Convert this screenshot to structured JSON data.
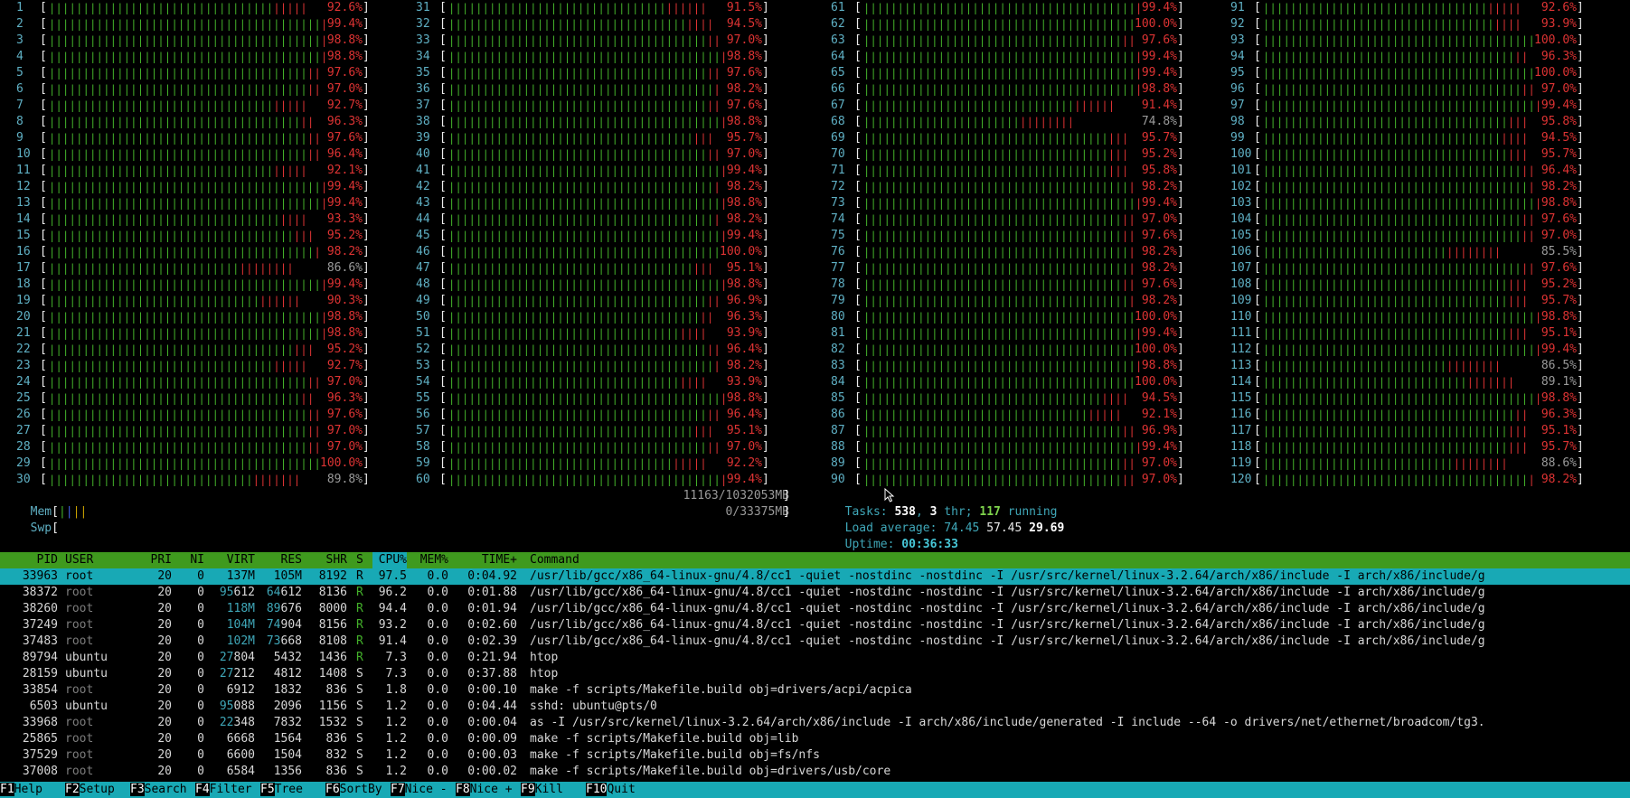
{
  "cpu_columns": [
    {
      "ids": [
        "1",
        "2",
        "3",
        "4",
        "5",
        "6",
        "7",
        "8",
        "9",
        "10",
        "11",
        "12",
        "13",
        "14",
        "15",
        "16",
        "17",
        "18",
        "19",
        "20",
        "21",
        "22",
        "23",
        "24",
        "25",
        "26",
        "27",
        "28",
        "29",
        "30"
      ],
      "values": [
        "92.6%",
        "99.4%",
        "98.8%",
        "98.8%",
        "97.6%",
        "97.0%",
        "92.7%",
        "96.3%",
        "97.6%",
        "96.4%",
        "92.1%",
        "99.4%",
        "99.4%",
        "93.3%",
        "95.2%",
        "98.2%",
        "86.6%",
        "99.4%",
        "90.3%",
        "98.8%",
        "98.8%",
        "95.2%",
        "92.7%",
        "97.0%",
        "96.3%",
        "97.6%",
        "97.0%",
        "97.0%",
        "100.0%",
        "89.8%"
      ],
      "levels": [
        92.6,
        99.4,
        98.8,
        98.8,
        97.6,
        97.0,
        92.7,
        96.3,
        97.6,
        96.4,
        92.1,
        99.4,
        99.4,
        93.3,
        95.2,
        98.2,
        86.6,
        99.4,
        90.3,
        98.8,
        98.8,
        95.2,
        92.7,
        97.0,
        96.3,
        97.6,
        97.0,
        97.0,
        100.0,
        89.8
      ]
    },
    {
      "ids": [
        "31",
        "32",
        "33",
        "34",
        "35",
        "36",
        "37",
        "38",
        "39",
        "40",
        "41",
        "42",
        "43",
        "44",
        "45",
        "46",
        "47",
        "48",
        "49",
        "50",
        "51",
        "52",
        "53",
        "54",
        "55",
        "56",
        "57",
        "58",
        "59",
        "60"
      ],
      "values": [
        "91.5%",
        "94.5%",
        "97.0%",
        "98.8%",
        "97.6%",
        "98.2%",
        "97.6%",
        "98.8%",
        "95.7%",
        "97.0%",
        "99.4%",
        "98.2%",
        "98.8%",
        "98.2%",
        "99.4%",
        "100.0%",
        "95.1%",
        "98.8%",
        "96.9%",
        "96.3%",
        "93.9%",
        "96.4%",
        "98.2%",
        "93.9%",
        "98.8%",
        "96.4%",
        "95.1%",
        "97.0%",
        "92.2%",
        "99.4%"
      ],
      "levels": [
        91.5,
        94.5,
        97.0,
        98.8,
        97.6,
        98.2,
        97.6,
        98.8,
        95.7,
        97.0,
        99.4,
        98.2,
        98.8,
        98.2,
        99.4,
        100.0,
        95.1,
        98.8,
        96.9,
        96.3,
        93.9,
        96.4,
        98.2,
        93.9,
        98.8,
        96.4,
        95.1,
        97.0,
        92.2,
        99.4
      ]
    },
    {
      "ids": [
        "61",
        "62",
        "63",
        "64",
        "65",
        "66",
        "67",
        "68",
        "69",
        "70",
        "71",
        "72",
        "73",
        "74",
        "75",
        "76",
        "77",
        "78",
        "79",
        "80",
        "81",
        "82",
        "83",
        "84",
        "85",
        "86",
        "87",
        "88",
        "89",
        "90"
      ],
      "values": [
        "99.4%",
        "100.0%",
        "97.6%",
        "99.4%",
        "99.4%",
        "98.8%",
        "91.4%",
        "74.8%",
        "95.7%",
        "95.2%",
        "95.8%",
        "98.2%",
        "99.4%",
        "97.0%",
        "97.6%",
        "98.2%",
        "98.2%",
        "97.6%",
        "98.2%",
        "100.0%",
        "99.4%",
        "100.0%",
        "98.8%",
        "100.0%",
        "94.5%",
        "92.1%",
        "96.9%",
        "99.4%",
        "97.0%",
        "97.0%"
      ],
      "levels": [
        99.4,
        100.0,
        97.6,
        99.4,
        99.4,
        98.8,
        91.4,
        74.8,
        95.7,
        95.2,
        95.8,
        98.2,
        99.4,
        97.0,
        97.6,
        98.2,
        98.2,
        97.6,
        98.2,
        100.0,
        99.4,
        100.0,
        98.8,
        100.0,
        94.5,
        92.1,
        96.9,
        99.4,
        97.0,
        97.0
      ]
    },
    {
      "ids": [
        "91",
        "92",
        "93",
        "94",
        "95",
        "96",
        "97",
        "98",
        "99",
        "100",
        "101",
        "102",
        "103",
        "104",
        "105",
        "106",
        "107",
        "108",
        "109",
        "110",
        "111",
        "112",
        "113",
        "114",
        "115",
        "116",
        "117",
        "118",
        "119",
        "120"
      ],
      "values": [
        "92.6%",
        "93.9%",
        "100.0%",
        "96.3%",
        "100.0%",
        "97.0%",
        "99.4%",
        "95.8%",
        "94.5%",
        "95.7%",
        "96.4%",
        "98.2%",
        "98.8%",
        "97.6%",
        "97.0%",
        "85.5%",
        "97.6%",
        "95.2%",
        "95.7%",
        "98.8%",
        "95.1%",
        "99.4%",
        "86.5%",
        "89.1%",
        "98.8%",
        "96.3%",
        "95.1%",
        "95.7%",
        "88.6%",
        "98.2%"
      ],
      "levels": [
        92.6,
        93.9,
        100.0,
        96.3,
        100.0,
        97.0,
        99.4,
        95.8,
        94.5,
        95.7,
        96.4,
        98.2,
        98.8,
        97.6,
        97.0,
        85.5,
        97.6,
        95.2,
        95.7,
        98.8,
        95.1,
        99.4,
        86.5,
        89.1,
        98.8,
        96.3,
        95.1,
        95.7,
        88.6,
        98.2
      ]
    }
  ],
  "mem": {
    "label": "Mem",
    "value": "11163/1032053MB",
    "level": 1.1
  },
  "swp": {
    "label": "Swp",
    "value": "0/33375MB",
    "level": 0
  },
  "tasks": {
    "label": "Tasks:",
    "count": "538",
    "sep1": ",",
    "thr": "3",
    "thr_label": "thr;",
    "running": "117",
    "running_label": "running"
  },
  "load": {
    "label": "Load average:",
    "l1": "74.45",
    "l5": "57.45",
    "l15": "29.69"
  },
  "uptime": {
    "label": "Uptime:",
    "value": "00:36:33"
  },
  "table": {
    "headers": {
      "pid": "PID",
      "user": "USER",
      "pri": "PRI",
      "ni": "NI",
      "virt": "VIRT",
      "res": "RES",
      "shr": "SHR",
      "s": "S",
      "cpu": "CPU%",
      "mem": "MEM%",
      "time": "TIME+",
      "cmd": "Command"
    },
    "rows": [
      {
        "pid": "33963",
        "user": "root",
        "pri": "20",
        "ni": "0",
        "virt": "137M",
        "res": "105M",
        "shr": "8192",
        "s": "R",
        "cpu": "97.5",
        "mem": "0.0",
        "time": "0:04.92",
        "cmd": "/usr/lib/gcc/x86_64-linux-gnu/4.8/cc1 -quiet -nostdinc -nostdinc -I /usr/src/kernel/linux-3.2.64/arch/x86/include -I arch/x86/include/g",
        "selected": true
      },
      {
        "pid": "38372",
        "user": "root",
        "pri": "20",
        "ni": "0",
        "virt": "95612",
        "res": "64612",
        "shr": "8136",
        "s": "R",
        "cpu": "96.2",
        "mem": "0.0",
        "time": "0:01.88",
        "cmd": "/usr/lib/gcc/x86_64-linux-gnu/4.8/cc1 -quiet -nostdinc -nostdinc -I /usr/src/kernel/linux-3.2.64/arch/x86/include -I arch/x86/include/g"
      },
      {
        "pid": "38260",
        "user": "root",
        "pri": "20",
        "ni": "0",
        "virt": "118M",
        "res": "89676",
        "shr": "8000",
        "s": "R",
        "cpu": "94.4",
        "mem": "0.0",
        "time": "0:01.94",
        "cmd": "/usr/lib/gcc/x86_64-linux-gnu/4.8/cc1 -quiet -nostdinc -nostdinc -I /usr/src/kernel/linux-3.2.64/arch/x86/include -I arch/x86/include/g"
      },
      {
        "pid": "37249",
        "user": "root",
        "pri": "20",
        "ni": "0",
        "virt": "104M",
        "res": "74904",
        "shr": "8156",
        "s": "R",
        "cpu": "93.2",
        "mem": "0.0",
        "time": "0:02.60",
        "cmd": "/usr/lib/gcc/x86_64-linux-gnu/4.8/cc1 -quiet -nostdinc -nostdinc -I /usr/src/kernel/linux-3.2.64/arch/x86/include -I arch/x86/include/g"
      },
      {
        "pid": "37483",
        "user": "root",
        "pri": "20",
        "ni": "0",
        "virt": "102M",
        "res": "73668",
        "shr": "8108",
        "s": "R",
        "cpu": "91.4",
        "mem": "0.0",
        "time": "0:02.39",
        "cmd": "/usr/lib/gcc/x86_64-linux-gnu/4.8/cc1 -quiet -nostdinc -nostdinc -I /usr/src/kernel/linux-3.2.64/arch/x86/include -I arch/x86/include/g"
      },
      {
        "pid": "89794",
        "user": "ubuntu",
        "pri": "20",
        "ni": "0",
        "virt": "27804",
        "res": "5432",
        "shr": "1436",
        "s": "R",
        "cpu": "7.3",
        "mem": "0.0",
        "time": "0:21.94",
        "cmd": "htop"
      },
      {
        "pid": "28159",
        "user": "ubuntu",
        "pri": "20",
        "ni": "0",
        "virt": "27212",
        "res": "4812",
        "shr": "1408",
        "s": "S",
        "cpu": "7.3",
        "mem": "0.0",
        "time": "0:37.88",
        "cmd": "htop"
      },
      {
        "pid": "33854",
        "user": "root",
        "pri": "20",
        "ni": "0",
        "virt": "6912",
        "res": "1832",
        "shr": "836",
        "s": "S",
        "cpu": "1.8",
        "mem": "0.0",
        "time": "0:00.10",
        "cmd": "make -f scripts/Makefile.build obj=drivers/acpi/acpica"
      },
      {
        "pid": "6503",
        "user": "ubuntu",
        "pri": "20",
        "ni": "0",
        "virt": "95088",
        "res": "2096",
        "shr": "1156",
        "s": "S",
        "cpu": "1.2",
        "mem": "0.0",
        "time": "0:04.44",
        "cmd": "sshd: ubuntu@pts/0"
      },
      {
        "pid": "33968",
        "user": "root",
        "pri": "20",
        "ni": "0",
        "virt": "22348",
        "res": "7832",
        "shr": "1532",
        "s": "S",
        "cpu": "1.2",
        "mem": "0.0",
        "time": "0:00.04",
        "cmd": "as -I /usr/src/kernel/linux-3.2.64/arch/x86/include -I arch/x86/include/generated -I include --64 -o drivers/net/ethernet/broadcom/tg3."
      },
      {
        "pid": "25865",
        "user": "root",
        "pri": "20",
        "ni": "0",
        "virt": "6668",
        "res": "1564",
        "shr": "836",
        "s": "S",
        "cpu": "1.2",
        "mem": "0.0",
        "time": "0:00.09",
        "cmd": "make -f scripts/Makefile.build obj=lib"
      },
      {
        "pid": "37529",
        "user": "root",
        "pri": "20",
        "ni": "0",
        "virt": "6600",
        "res": "1504",
        "shr": "832",
        "s": "S",
        "cpu": "1.2",
        "mem": "0.0",
        "time": "0:00.03",
        "cmd": "make -f scripts/Makefile.build obj=fs/nfs"
      },
      {
        "pid": "37008",
        "user": "root",
        "pri": "20",
        "ni": "0",
        "virt": "6584",
        "res": "1356",
        "shr": "836",
        "s": "S",
        "cpu": "1.2",
        "mem": "0.0",
        "time": "0:00.02",
        "cmd": "make -f scripts/Makefile.build obj=drivers/usb/core"
      }
    ]
  },
  "footer": [
    {
      "key": "F1",
      "label": "Help"
    },
    {
      "key": "F2",
      "label": "Setup"
    },
    {
      "key": "F3",
      "label": "Search"
    },
    {
      "key": "F4",
      "label": "Filter"
    },
    {
      "key": "F5",
      "label": "Tree"
    },
    {
      "key": "F6",
      "label": "SortBy"
    },
    {
      "key": "F7",
      "label": "Nice -"
    },
    {
      "key": "F8",
      "label": "Nice +"
    },
    {
      "key": "F9",
      "label": "Kill"
    },
    {
      "key": "F10",
      "label": "Quit"
    }
  ],
  "colors": {
    "bar_green": "#43b02a",
    "bar_red": "#d33",
    "header_bg": "#3f9a1e",
    "selected_bg": "#18a9b5",
    "footer_bg": "#18a9b5",
    "num_cyan": "#5fb0c4"
  }
}
